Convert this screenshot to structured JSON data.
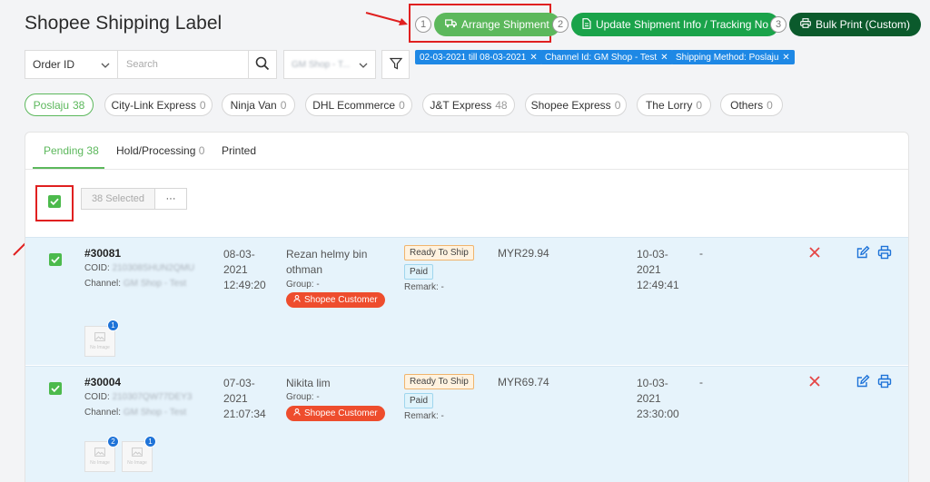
{
  "page": {
    "title": "Shopee Shipping Label"
  },
  "steps": [
    {
      "num": "1",
      "label": "Arrange Shipment",
      "color": "#5cb85c"
    },
    {
      "num": "2",
      "label": "Update Shipment Info / Tracking No",
      "color": "#1aa34a"
    },
    {
      "num": "3",
      "label": "Bulk Print (Custom)",
      "color": "#0b5a2c"
    }
  ],
  "filters": {
    "search_by": "Order ID",
    "search_placeholder": "Search",
    "shop": "GM Shop - T...",
    "tags": [
      "02-03-2021 till 08-03-2021",
      "Channel Id: GM Shop - Test",
      "Shipping Method: Poslaju"
    ]
  },
  "couriers": [
    {
      "name": "Poslaju",
      "count": "38"
    },
    {
      "name": "City-Link Express",
      "count": "0"
    },
    {
      "name": "Ninja Van",
      "count": "0"
    },
    {
      "name": "DHL Ecommerce",
      "count": "0"
    },
    {
      "name": "J&T Express",
      "count": "48"
    },
    {
      "name": "Shopee Express",
      "count": "0"
    },
    {
      "name": "The Lorry",
      "count": "0"
    },
    {
      "name": "Others",
      "count": "0"
    }
  ],
  "tabs": [
    {
      "name": "Pending",
      "count": "38"
    },
    {
      "name": "Hold/Processing",
      "count": "0"
    },
    {
      "name": "Printed",
      "count": ""
    }
  ],
  "selection": {
    "label": "38 Selected",
    "more": "···"
  },
  "orders": [
    {
      "id": "#30081",
      "coid_label": "COID:",
      "coid": "210308SHUN2QMU",
      "channel_label": "Channel:",
      "channel": "GM Shop - Test",
      "date1": "08-03-",
      "date2": "2021",
      "time": "12:49:20",
      "name1": "Rezan helmy bin",
      "name2": "othman",
      "group": "Group: -",
      "customer_tag": "Shopee Customer",
      "status": "Ready To Ship",
      "payment": "Paid",
      "remark": "Remark: -",
      "amount": "MYR29.94",
      "ship_date1": "10-03-",
      "ship_date2": "2021",
      "ship_time": "12:49:41",
      "extra": "-",
      "thumbs": [
        "1"
      ]
    },
    {
      "id": "#30004",
      "coid_label": "COID:",
      "coid": "210307QW77DEY3",
      "channel_label": "Channel:",
      "channel": "GM Shop - Test",
      "date1": "07-03-",
      "date2": "2021",
      "time": "21:07:34",
      "name1": "Nikita lim",
      "name2": "",
      "group": "Group: -",
      "customer_tag": "Shopee Customer",
      "status": "Ready To Ship",
      "payment": "Paid",
      "remark": "Remark: -",
      "amount": "MYR69.74",
      "ship_date1": "10-03-",
      "ship_date2": "2021",
      "ship_time": "23:30:00",
      "extra": "-",
      "thumbs": [
        "2",
        "1"
      ]
    }
  ],
  "no_image_text": "No Image"
}
